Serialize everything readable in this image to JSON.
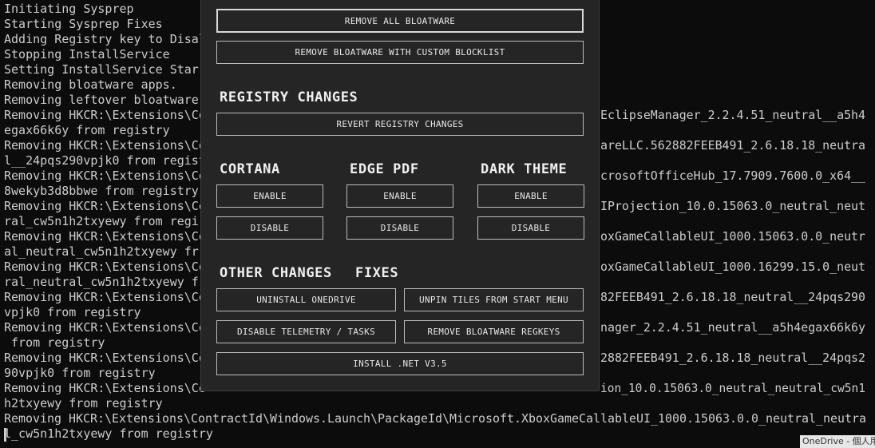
{
  "console": {
    "lines": [
      "Initiating Sysprep",
      "Starting Sysprep Fixes",
      "Adding Registry key to Disal",
      "Stopping InstallService",
      "Setting InstallService Star",
      "Removing bloatware apps.",
      "Removing leftover bloatware",
      "Removing HKCR:\\Extensions\\Co",
      "egax66k6y from registry",
      "Removing HKCR:\\Extensions\\Co",
      "l__24pqs290vpjk0 from regist",
      "Removing HKCR:\\Extensions\\Co",
      "8wekyb3d8bbwe from registry",
      "Removing HKCR:\\Extensions\\Co",
      "ral_cw5n1h2txyewy from regi",
      "Removing HKCR:\\Extensions\\Co",
      "al_neutral_cw5n1h2txyewy fr",
      "Removing HKCR:\\Extensions\\Co",
      "ral_neutral_cw5n1h2txyewy f",
      "Removing HKCR:\\Extensions\\Co",
      "vpjk0 from registry",
      "Removing HKCR:\\Extensions\\Co",
      " from registry",
      "Removing HKCR:\\Extensions\\Co",
      "90vpjk0 from registry",
      "Removing HKCR:\\Extensions\\Co",
      "h2txyewy from registry",
      "Removing HKCR:\\Extensions\\ContractId\\Windows.Launch\\PackageId\\Microsoft.XboxGameCallableUI_1000.15063.0.0_neutral_neutra",
      "l_cw5n1h2txyewy from registry"
    ],
    "right_fragments": [
      {
        "row": 7,
        "text": "EclipseManager_2.2.4.51_neutral__a5h4"
      },
      {
        "row": 9,
        "text": "areLLC.562882FEEB491_2.6.18.18_neutra"
      },
      {
        "row": 11,
        "text": "crosoftOfficeHub_17.7909.7600.0_x64__"
      },
      {
        "row": 13,
        "text": "IProjection_10.0.15063.0_neutral_neut"
      },
      {
        "row": 15,
        "text": "oxGameCallableUI_1000.15063.0.0_neutr"
      },
      {
        "row": 17,
        "text": "oxGameCallableUI_1000.16299.15.0_neut"
      },
      {
        "row": 19,
        "text": "82FEEB491_2.6.18.18_neutral__24pqs290"
      },
      {
        "row": 21,
        "text": "nager_2.2.4.51_neutral__a5h4egax66k6y"
      },
      {
        "row": 23,
        "text": "2882FEEB491_2.6.18.18_neutral__24pqs2"
      },
      {
        "row": 25,
        "text": "ion_10.0.15063.0_neutral_neutral_cw5n1"
      }
    ]
  },
  "panel": {
    "remove_all_label": "REMOVE ALL BLOATWARE",
    "remove_custom_label": "REMOVE BLOATWARE WITH CUSTOM BLOCKLIST",
    "registry_heading": "REGISTRY CHANGES",
    "revert_registry_label": "REVERT REGISTRY CHANGES",
    "cortana_heading": "CORTANA",
    "edge_pdf_heading": "EDGE PDF",
    "dark_theme_heading": "DARK THEME",
    "enable_label": "ENABLE",
    "disable_label": "DISABLE",
    "other_heading": "OTHER CHANGES",
    "fixes_heading": "FIXES",
    "uninstall_onedrive_label": "UNINSTALL ONEDRIVE",
    "unpin_tiles_label": "UNPIN TILES FROM START MENU",
    "disable_telemetry_label": "DISABLE TELEMETRY / TASKS",
    "remove_regkeys_label": "REMOVE BLOATWARE REGKEYS",
    "install_net_label": "INSTALL .NET V3.5"
  },
  "toast": {
    "text": "OneDrive - 個人用"
  }
}
